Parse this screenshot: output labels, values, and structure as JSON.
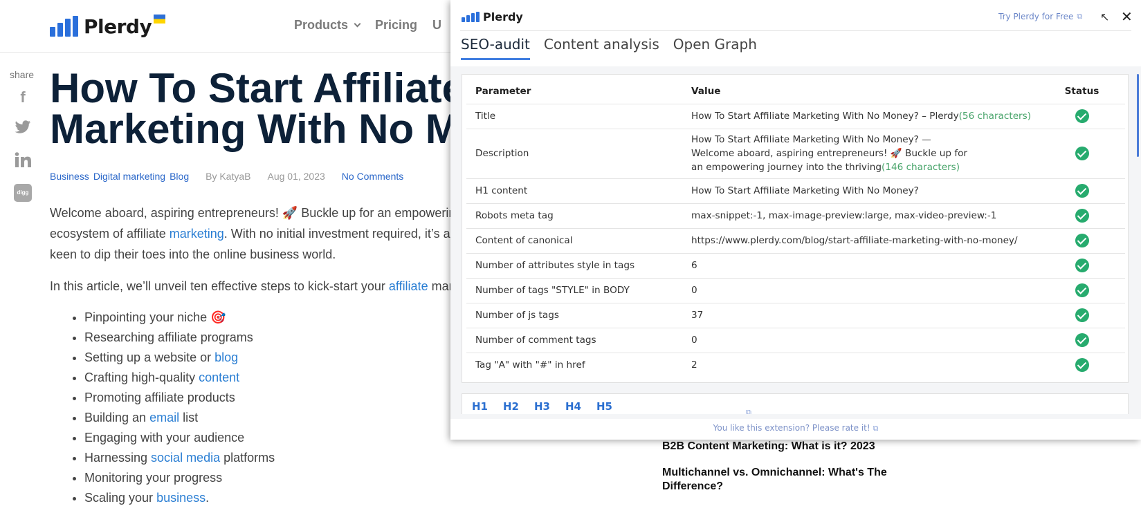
{
  "site": {
    "logo_text": "Plerdy",
    "nav": [
      {
        "label": "Products"
      },
      {
        "label": "Pricing"
      },
      {
        "label": "U"
      }
    ],
    "share_label": "share",
    "share_icons": [
      "facebook-icon",
      "twitter-icon",
      "linkedin-icon",
      "digg-icon"
    ],
    "digg_text": "digg",
    "title": "How To Start Affiliate Marketing With No M",
    "title_line1": "How To Start Affiliate",
    "title_line2": "Marketing With No M",
    "meta": {
      "categories": [
        "Business",
        "Digital marketing",
        "Blog"
      ],
      "author": "By KatyaB",
      "date": "Aug 01, 2023",
      "comments": "No Comments"
    },
    "intro": {
      "part1": "Welcome aboard, aspiring entrepreneurs! 🚀 Buckle up for an empowerin",
      "part2": "ecosystem of affiliate ",
      "link": "marketing",
      "part3": ". With no initial investment required, it’s a",
      "part4": "keen to dip their toes into the online business world."
    },
    "article_line": {
      "text": "In this article, we’ll unveil ten effective steps to kick-start your ",
      "link": "affiliate",
      "tail": " mar"
    },
    "steps": [
      {
        "text": "Pinpointing your niche 🎯",
        "link": "",
        "tail": ""
      },
      {
        "text": "Researching affiliate programs",
        "link": "",
        "tail": ""
      },
      {
        "text": "Setting up a website or ",
        "link": "blog",
        "tail": ""
      },
      {
        "text": "Crafting high-quality ",
        "link": "content",
        "tail": ""
      },
      {
        "text": "Promoting affiliate products",
        "link": "",
        "tail": ""
      },
      {
        "text": "Building an ",
        "link": "email",
        "tail": " list"
      },
      {
        "text": "Engaging with your audience",
        "link": "",
        "tail": ""
      },
      {
        "text": "Harnessing ",
        "link": "social media",
        "tail": " platforms"
      },
      {
        "text": "Monitoring your progress",
        "link": "",
        "tail": ""
      },
      {
        "text": "Scaling your ",
        "link": "business",
        "tail": "."
      }
    ],
    "related": [
      "B2B Content Marketing: What is it? 2023",
      "Multichannel vs. Omnichannel: What's The Difference?"
    ]
  },
  "extension": {
    "logo_text": "Plerdy",
    "try_free": "Try Plerdy for Free",
    "tabs": [
      "SEO-audit",
      "Content analysis",
      "Open Graph"
    ],
    "active_tab": "SEO-audit",
    "table": {
      "headers": [
        "Parameter",
        "Value",
        "Status"
      ],
      "rows": [
        {
          "param": "Title",
          "value": "How To Start Affiliate Marketing With No Money? – Plerdy",
          "chars": "(56 characters)",
          "status": "ok"
        },
        {
          "param": "Description",
          "value": "How To Start Affiliate Marketing With No Money? — Welcome aboard, aspiring entrepreneurs! 🚀 Buckle up for an empowering journey into the thriving",
          "chars": "(146 characters)",
          "status": "ok"
        },
        {
          "param": "H1 content",
          "value": "How To Start Affiliate Marketing With No Money?",
          "chars": "",
          "status": "ok"
        },
        {
          "param": "Robots meta tag",
          "value": "max-snippet:-1, max-image-preview:large, max-video-preview:-1",
          "chars": "",
          "status": "ok"
        },
        {
          "param": "Content of canonical",
          "value": "https://www.plerdy.com/blog/start-affiliate-marketing-with-no-money/",
          "chars": "",
          "status": "ok"
        },
        {
          "param": "Number of attributes style in tags",
          "value": "6",
          "chars": "",
          "status": "ok"
        },
        {
          "param": "Number of tags \"STYLE\" in BODY",
          "value": "0",
          "chars": "",
          "status": "ok"
        },
        {
          "param": "Number of js tags",
          "value": "37",
          "chars": "",
          "status": "ok"
        },
        {
          "param": "Number of comment tags",
          "value": "0",
          "chars": "",
          "status": "ok"
        },
        {
          "param": "Tag \"A\" with \"#\" in href",
          "value": "2",
          "chars": "",
          "status": "ok"
        }
      ]
    },
    "heading_tabs": [
      "H1",
      "H2",
      "H3",
      "H4",
      "H5"
    ],
    "footer": "You like this extension? Please rate it!"
  },
  "colors": {
    "accent": "#2a6fdb",
    "ok": "#27ab6e",
    "link": "#2a7ed3",
    "chars": "#48a46a"
  }
}
